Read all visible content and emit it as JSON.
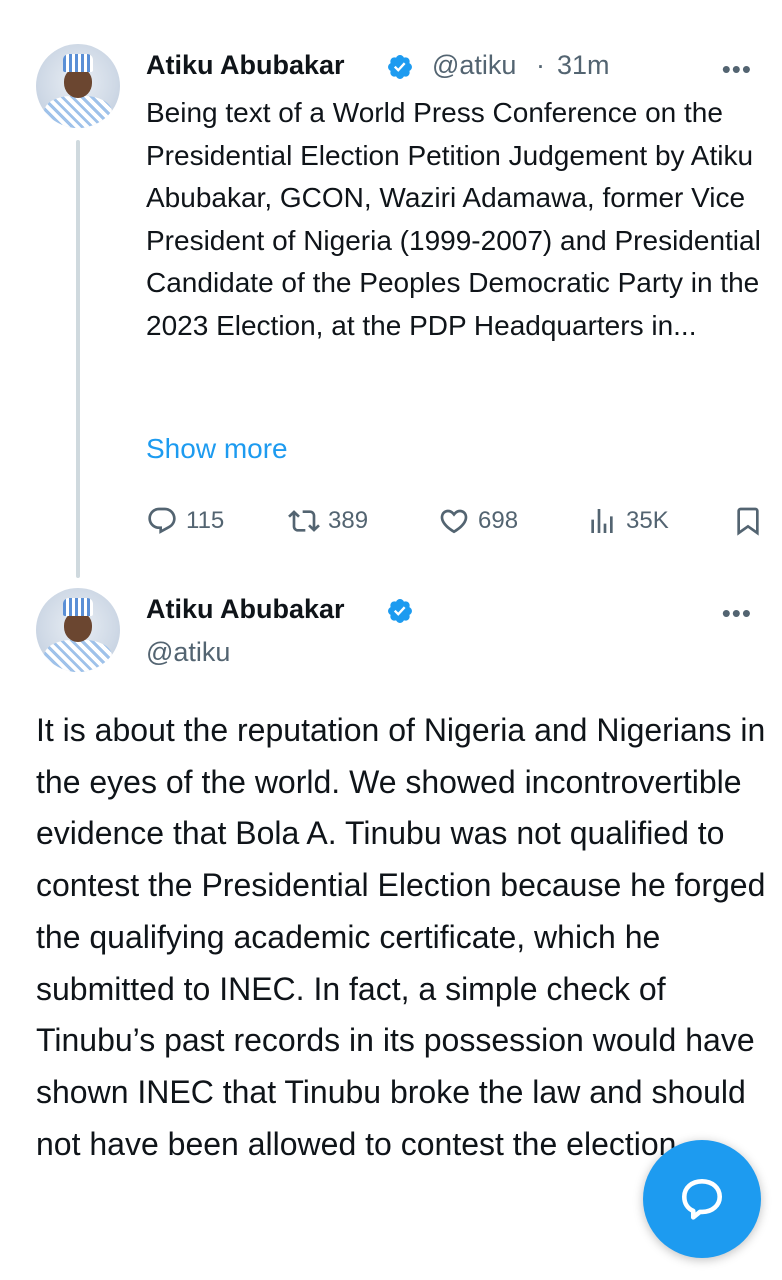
{
  "tweet1": {
    "author_name": "Atiku Abubakar",
    "handle": "@atiku",
    "separator": "·",
    "time": "31m",
    "more_label": "•••",
    "text": "Being text of a World Press Conference on the Presidential Election Petition Judgement by Atiku Abubakar, GCON, Waziri Adamawa, former Vice President of Nigeria (1999-2007) and Presidential Candidate of the Peoples Democratic Party in the 2023 Election, at the PDP Headquarters in...",
    "show_more": "Show more",
    "actions": {
      "replies": "115",
      "reposts": "389",
      "likes": "698",
      "views": "35K"
    },
    "icons": [
      "reply-icon",
      "repost-icon",
      "like-icon",
      "views-icon",
      "bookmark-icon"
    ]
  },
  "tweet2": {
    "author_name": "Atiku Abubakar",
    "handle": "@atiku",
    "more_label": "•••",
    "text": "It is about the reputation of Nigeria and Nigerians in the eyes of the world. We showed incontrovertible evidence that Bola A. Tinubu was not qualified to contest the Presidential Election because he forged the qualifying academic certificate, which he submitted to INEC. In fact, a simple check of Tinubu’s past records in its possession would have shown INEC that Tinubu broke the law and should not have been allowed to contest the election."
  },
  "fab": {
    "icon": "compose-message-icon"
  },
  "colors": {
    "accent": "#1d9bf0",
    "text": "#0f1419",
    "muted": "#536471",
    "thread_line": "#cfd9de"
  }
}
